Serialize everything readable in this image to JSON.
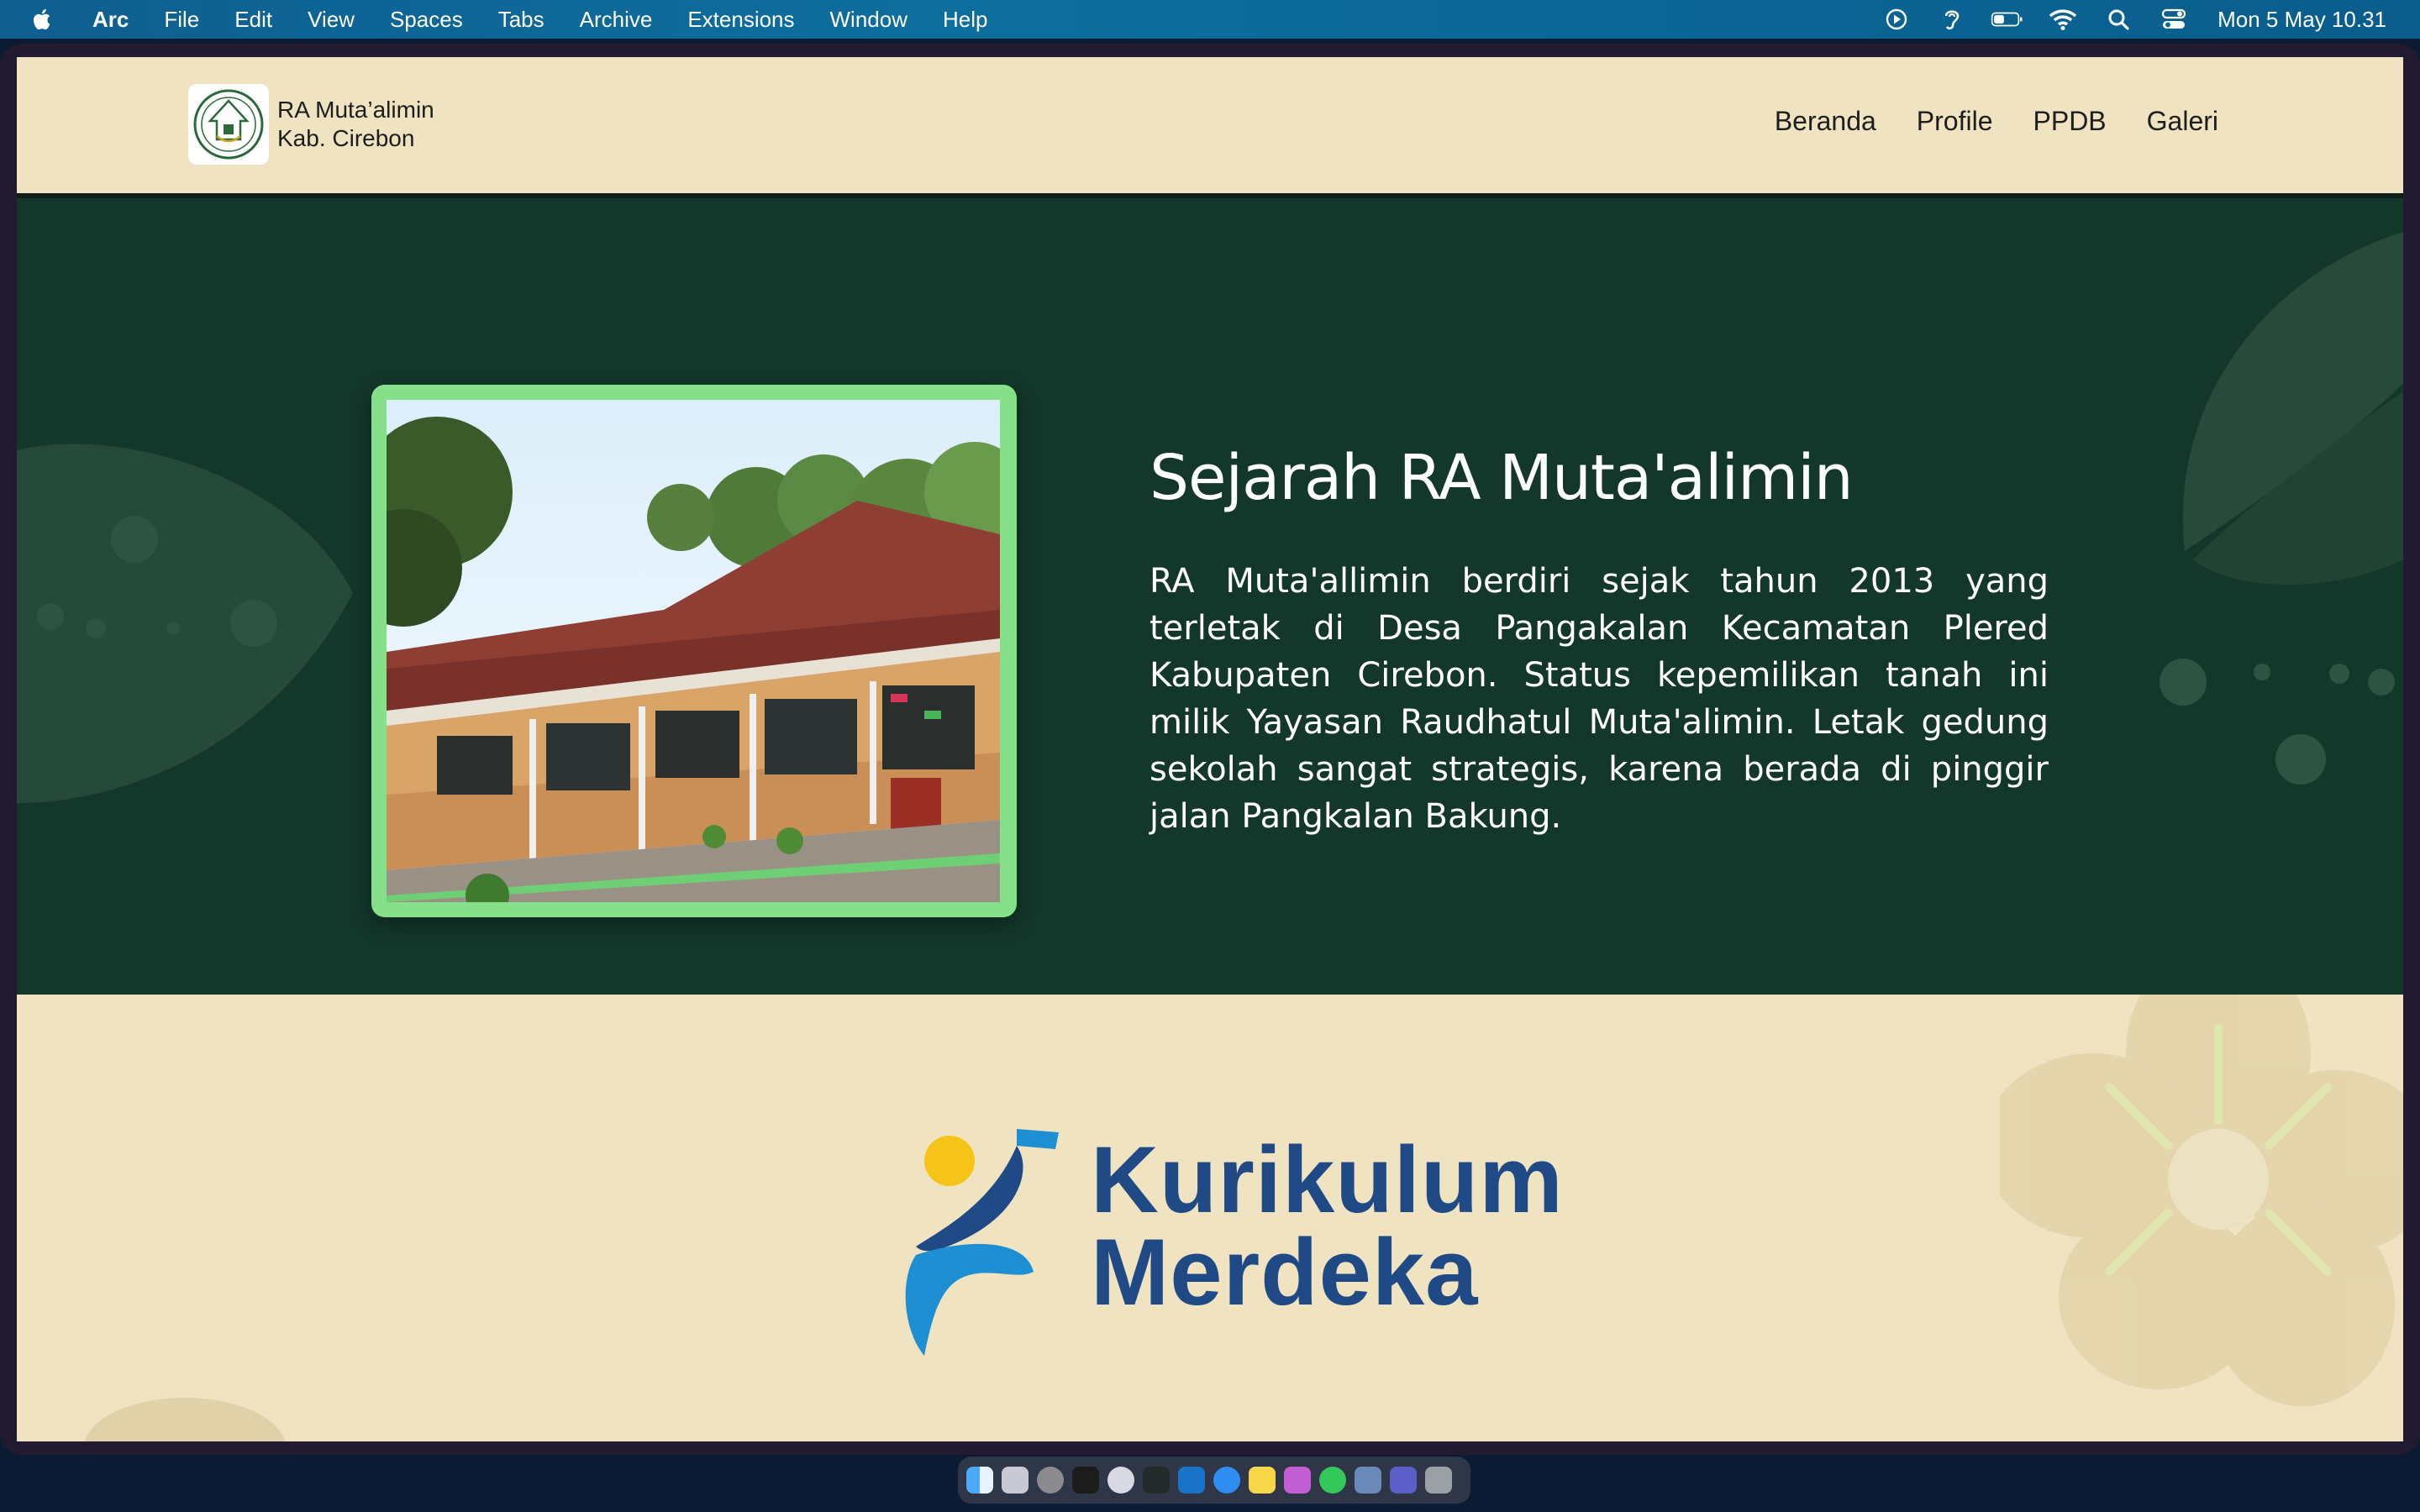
{
  "menubar": {
    "apple_icon": "apple-icon",
    "app_name": "Arc",
    "menus": [
      "File",
      "Edit",
      "View",
      "Spaces",
      "Tabs",
      "Archive",
      "Extensions",
      "Window",
      "Help"
    ],
    "status_icons": [
      "play-icon",
      "hearing-icon",
      "battery-icon",
      "wifi-icon",
      "search-icon",
      "control-center-icon"
    ],
    "clock": "Mon 5 May  10.31"
  },
  "header": {
    "logo_icon": "school-emblem-icon",
    "brand_line1": "RA Muta’alimin",
    "brand_line2": "Kab. Cirebon",
    "nav": [
      "Beranda",
      "Profile",
      "PPDB",
      "Galeri"
    ]
  },
  "history": {
    "title": "Sejarah RA Muta'alimin",
    "text": "RA Muta'allimin berdiri sejak tahun 2013 yang terletak di Desa Pangakalan Kecamatan Plered Kabupaten Cirebon. Status kepemilikan tanah ini milik Yayasan Raudhatul Muta'alimin. Letak gedung sekolah sangat strategis, karena berada di pinggir jalan Pangkalan Bakung.",
    "image": "school-building-photo"
  },
  "kurikulum": {
    "line1": "Kurikulum",
    "line2": "Merdeka",
    "logo_icon": "kurikulum-merdeka-logo-icon"
  },
  "dock": {
    "apps": [
      "finder-icon",
      "launchpad-icon",
      "settings-icon",
      "terminal-icon",
      "chrome-icon",
      "iterm-icon",
      "vscode-icon",
      "safari-icon",
      "notes-icon",
      "figma-icon",
      "whatsapp-icon",
      "preview-icon",
      "teams-icon",
      "trash-icon"
    ]
  },
  "colors": {
    "menubar": "#0d6e9e",
    "header_bg": "#f0e3c1",
    "history_bg": "#13372a",
    "photo_frame": "#86e08a",
    "kurikulum_blue": "#1f4a85",
    "kurikulum_light_blue": "#1e8fd2",
    "sun_yellow": "#f6c319"
  }
}
